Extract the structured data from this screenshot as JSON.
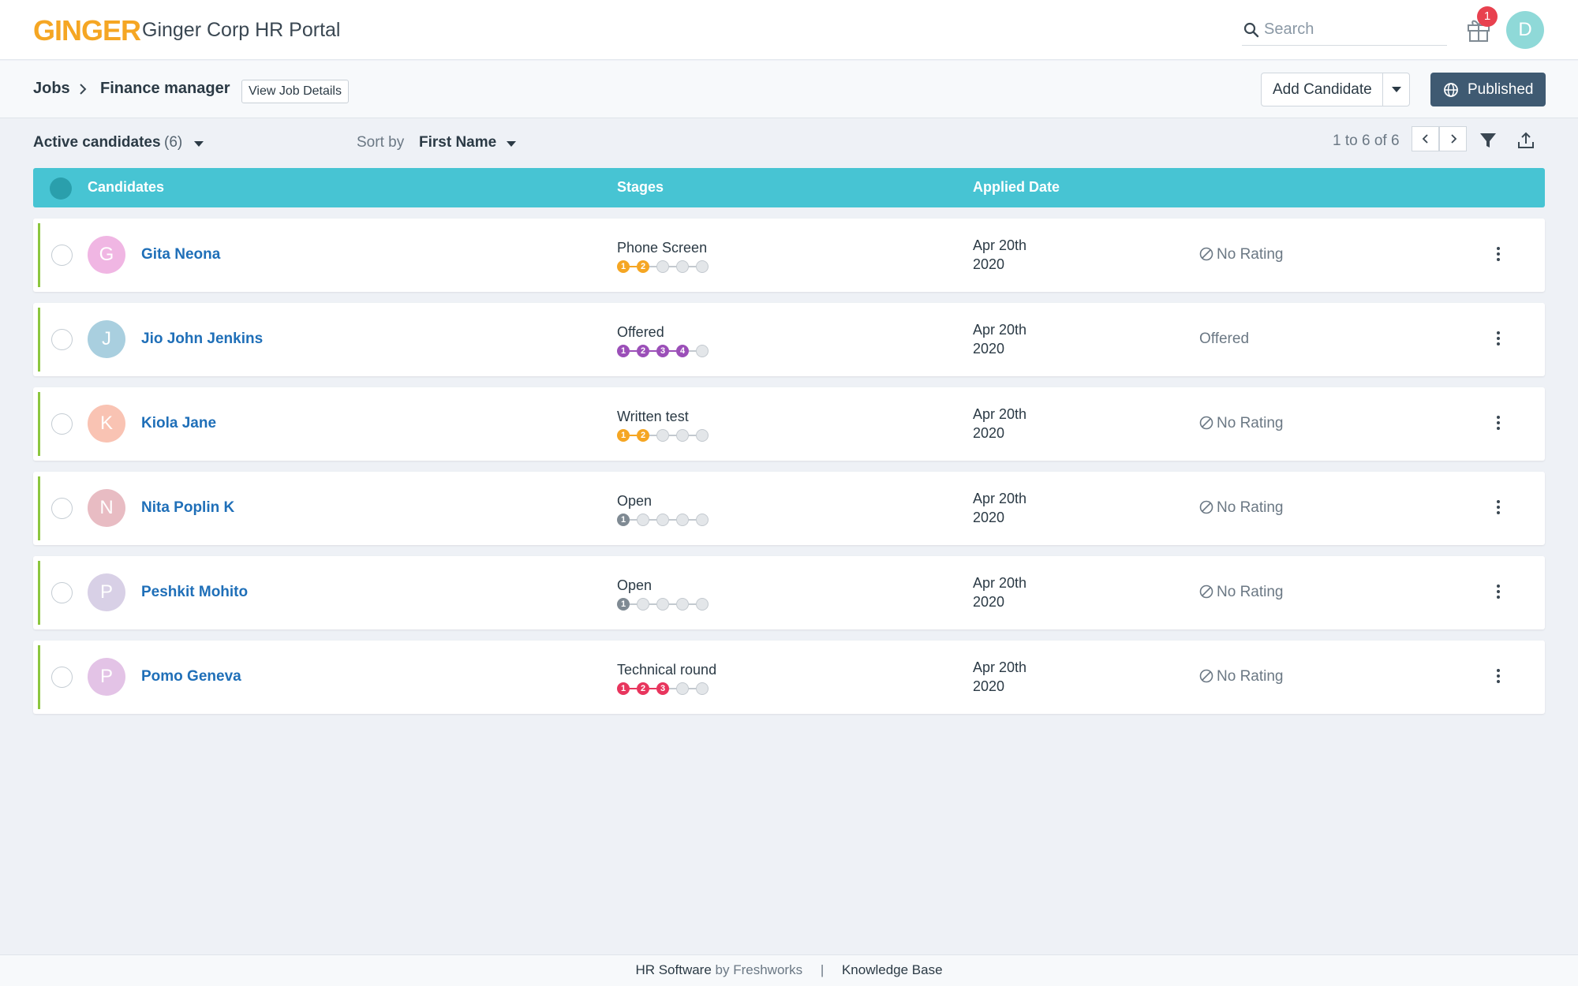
{
  "header": {
    "logo": "GINGER",
    "title": "Ginger Corp HR Portal",
    "search_placeholder": "Search",
    "notification_count": "1",
    "user_initial": "D"
  },
  "breadcrumb": {
    "root": "Jobs",
    "current": "Finance manager",
    "view_details": "View Job Details"
  },
  "actions": {
    "add_candidate": "Add Candidate",
    "published": "Published"
  },
  "toolbar": {
    "active_label": "Active candidates",
    "active_count": "(6)",
    "sort_label": "Sort by",
    "sort_value": "First Name",
    "pagination": "1 to 6 of 6"
  },
  "table": {
    "columns": [
      "Candidates",
      "Stages",
      "Applied Date"
    ],
    "rows": [
      {
        "initial": "G",
        "avatar_color": "#f0b6e3",
        "name": "Gita Neona",
        "stage": "Phone Screen",
        "stage_color": "#f5a623",
        "stage_done": 2,
        "stage_total": 5,
        "date_line1": "Apr 20th",
        "date_line2": "2020",
        "rating": "No Rating",
        "rating_icon": true
      },
      {
        "initial": "J",
        "avatar_color": "#a9cfdf",
        "name": "Jio John Jenkins",
        "stage": "Offered",
        "stage_color": "#9b4fb8",
        "stage_done": 4,
        "stage_total": 5,
        "date_line1": "Apr 20th",
        "date_line2": "2020",
        "rating": "Offered",
        "rating_icon": false
      },
      {
        "initial": "K",
        "avatar_color": "#f9c3b3",
        "name": "Kiola Jane",
        "stage": "Written test",
        "stage_color": "#f5a623",
        "stage_done": 2,
        "stage_total": 5,
        "date_line1": "Apr 20th",
        "date_line2": "2020",
        "rating": "No Rating",
        "rating_icon": true
      },
      {
        "initial": "N",
        "avatar_color": "#e8bcc3",
        "name": "Nita Poplin K",
        "stage": "Open",
        "stage_color": "#7f8a93",
        "stage_done": 1,
        "stage_total": 5,
        "date_line1": "Apr 20th",
        "date_line2": "2020",
        "rating": "No Rating",
        "rating_icon": true
      },
      {
        "initial": "P",
        "avatar_color": "#d8d0e6",
        "name": "Peshkit Mohito",
        "stage": "Open",
        "stage_color": "#7f8a93",
        "stage_done": 1,
        "stage_total": 5,
        "date_line1": "Apr 20th",
        "date_line2": "2020",
        "rating": "No Rating",
        "rating_icon": true
      },
      {
        "initial": "P",
        "avatar_color": "#e3c3e6",
        "name": "Pomo Geneva",
        "stage": "Technical round",
        "stage_color": "#e8355d",
        "stage_done": 3,
        "stage_total": 5,
        "date_line1": "Apr 20th",
        "date_line2": "2020",
        "rating": "No Rating",
        "rating_icon": true
      }
    ]
  },
  "footer": {
    "product": "HR Software",
    "by": "by Freshworks",
    "separator": "|",
    "kb": "Knowledge Base"
  }
}
